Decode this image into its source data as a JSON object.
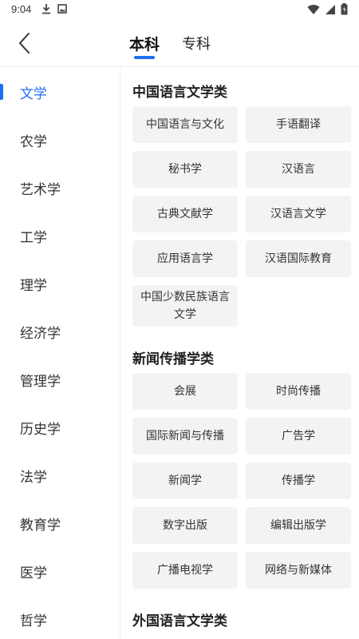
{
  "status": {
    "time": "9:04",
    "icons_left": [
      "download-icon",
      "photo-icon"
    ],
    "icons_right": [
      "wifi-icon",
      "signal-icon",
      "battery-icon"
    ]
  },
  "header": {
    "tabs": [
      {
        "label": "本科",
        "active": true
      },
      {
        "label": "专科",
        "active": false
      }
    ]
  },
  "sidebar": {
    "items": [
      {
        "label": "文学",
        "active": true
      },
      {
        "label": "农学"
      },
      {
        "label": "艺术学"
      },
      {
        "label": "工学"
      },
      {
        "label": "理学"
      },
      {
        "label": "经济学"
      },
      {
        "label": "管理学"
      },
      {
        "label": "历史学"
      },
      {
        "label": "法学"
      },
      {
        "label": "教育学"
      },
      {
        "label": "医学"
      },
      {
        "label": "哲学"
      }
    ]
  },
  "sections": [
    {
      "title": "中国语言文学类",
      "items": [
        "中国语言与文化",
        "手语翻译",
        "秘书学",
        "汉语言",
        "古典文献学",
        "汉语言文学",
        "应用语言学",
        "汉语国际教育",
        "中国少数民族语言文学"
      ]
    },
    {
      "title": "新闻传播学类",
      "items": [
        "会展",
        "时尚传播",
        "国际新闻与传播",
        "广告学",
        "新闻学",
        "传播学",
        "数字出版",
        "编辑出版学",
        "广播电视学",
        "网络与新媒体"
      ]
    },
    {
      "title": "外国语言文学类",
      "items": []
    }
  ],
  "colors": {
    "accent": "#1e6ff1",
    "chip_bg": "#f2f3f5"
  }
}
